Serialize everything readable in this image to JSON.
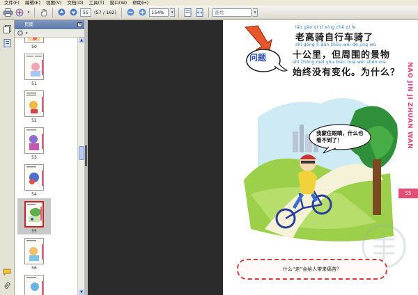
{
  "menu": [
    "文件(F)",
    "编辑(E)",
    "视图(V)",
    "文档(D)",
    "工具(T)",
    "窗口(W)",
    "帮助(H)"
  ],
  "toolbar": {
    "page_current": "55",
    "page_count": "(57 / 162)",
    "zoom": "154%",
    "find_placeholder": "查找"
  },
  "panel": {
    "title": "页面",
    "thumbnails": [
      {
        "label": "50"
      },
      {
        "label": "51"
      },
      {
        "label": "52"
      },
      {
        "label": "53"
      },
      {
        "label": "54"
      },
      {
        "label": "55"
      },
      {
        "label": "56"
      }
    ]
  },
  "page": {
    "question_label": "问题",
    "pinyin_1": "lǎo gāo qí  zì  xíng chē qí  le",
    "line_1": "老高骑自行车骑了",
    "pinyin_2": "shí gōng lǐ     dàn zhōu wéi de jǐng wù",
    "line_2": "十公里，但周围的景物",
    "pinyin_3": "shǐ zhōng méi yǒu biàn huà    wèi shén me",
    "line_3": "始终没有变化。为什么？",
    "bubble": "我蒙住眼睛，什么也看不到了！",
    "side_title": "NAO JIN JI ZHUAN WAN",
    "page_number": "55",
    "bottom_question": "什么“走”会给人带来痛苦？"
  },
  "colors": {
    "accent_pink": "#e54e76",
    "pinyin_blue": "#2277c8",
    "canvas_dark": "#2b2b2b",
    "panel_header": "#6b84b0"
  }
}
